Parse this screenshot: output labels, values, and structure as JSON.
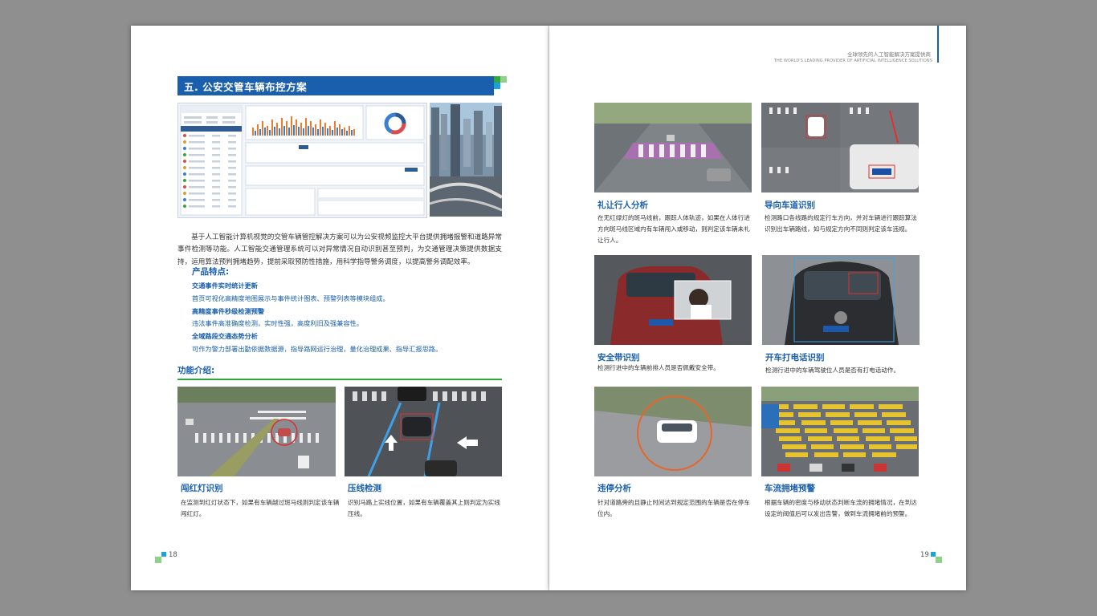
{
  "left_page": {
    "section_title": "五. 公安交管车辆布控方案",
    "intro_paragraph": "基于人工智能计算机视觉的交管车辆管控解决方案可以为公安视频监控大平台提供拥堵报警和道路异常事件检测等功能。人工智能交通管理系统可以对异常情况自动识别甚至预判，为交通管理决策提供数据支持，运用算法预判拥堵趋势，提前采取预防性措施，用科学指导警务调度，以提高警务调配效率。",
    "features_title": "产品特点:",
    "features": [
      {
        "heading": "交通事件实时统计更新",
        "desc": "首页可视化高精度地图展示与事件统计图表、预警列表等模块组成。"
      },
      {
        "heading": "高精度事件秒级检测预警",
        "desc": "违法事件高准确度检测，实时性强，高度利旧及强兼容性。"
      },
      {
        "heading": "全域路段交通态势分析",
        "desc": "可作为警力部署出勤依据数据源，指导路网运行治理，量化治理成果、指导汇报思路。"
      }
    ],
    "function_title": "功能介绍:",
    "functions": [
      {
        "title": "闯红灯识别",
        "desc": "在监测到红灯状态下，如果有车辆越过斑马线则判定该车辆闯红灯。"
      },
      {
        "title": "压线检测",
        "desc": "识别马路上实线位置，如果有车辆覆盖其上则判定为实线压线。"
      }
    ],
    "page_number": "18"
  },
  "right_page": {
    "header_cn": "全球领先的人工智能解决方案提供商",
    "header_en": "THE WORLD'S LEADING PROVIDER OF ARTIFICIAL INTELLIGENCE SOLUTIONS",
    "items": [
      {
        "title": "礼让行人分析",
        "desc": "在无红绿灯的斑马线前，跟踪人体轨迹，如果在人体行进方向斑马线区域内有车辆闯入或移动，则判定该车辆未礼让行人。"
      },
      {
        "title": "导向车道识别",
        "desc": "检测路口各线路的规定行车方向，并对车辆进行跟踪算法识别出车辆路线，如与规定方向不同则判定该车违规。"
      },
      {
        "title": "安全带识别",
        "desc": "检测行进中的车辆前排人员是否佩戴安全带。"
      },
      {
        "title": "开车打电话识别",
        "desc": "检测行进中的车辆驾驶位人员是否有打电话动作。"
      },
      {
        "title": "违停分析",
        "desc": "针对道路旁的且静止时间达到规定范围的车辆是否在停车位内。"
      },
      {
        "title": "车流拥堵预警",
        "desc": "根据车辆的密度与移动状态判断车流的拥堵情况，在到达设定的阈值后可以发出告警，做到车流拥堵前的预警。"
      }
    ],
    "page_number": "19"
  },
  "colors": {
    "brand_blue": "#1a5fae",
    "accent_green": "#2faa3a",
    "accent_cyan": "#1aa3d9"
  }
}
